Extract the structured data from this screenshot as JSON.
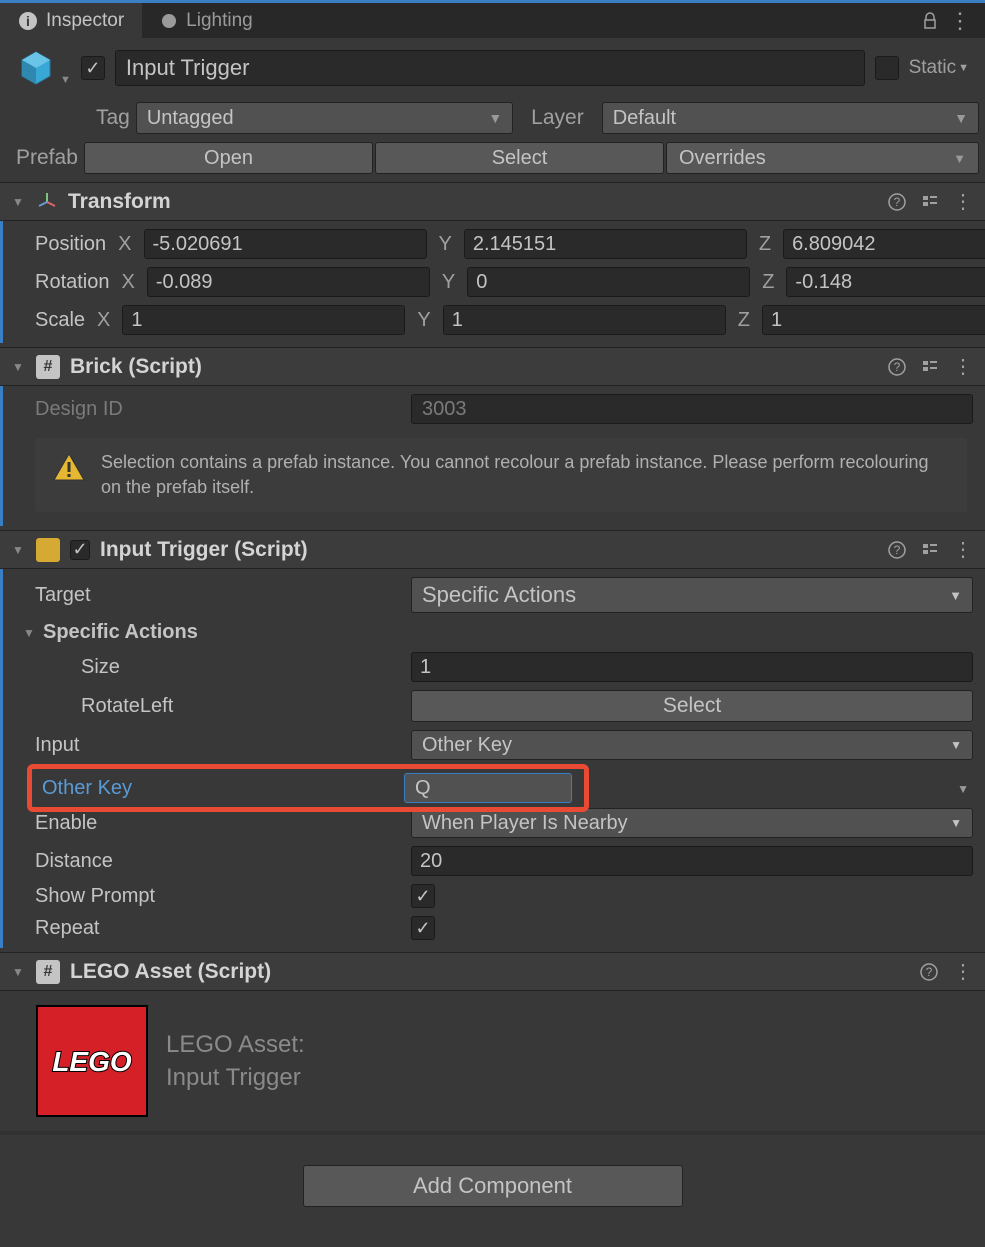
{
  "tabs": {
    "inspector": "Inspector",
    "lighting": "Lighting"
  },
  "header": {
    "name": "Input Trigger",
    "static": "Static",
    "tag_label": "Tag",
    "tag_value": "Untagged",
    "layer_label": "Layer",
    "layer_value": "Default"
  },
  "prefab": {
    "label": "Prefab",
    "open": "Open",
    "select": "Select",
    "overrides": "Overrides"
  },
  "transform": {
    "title": "Transform",
    "position": {
      "label": "Position",
      "x": "-5.020691",
      "y": "2.145151",
      "z": "6.809042"
    },
    "rotation": {
      "label": "Rotation",
      "x": "-0.089",
      "y": "0",
      "z": "-0.148"
    },
    "scale": {
      "label": "Scale",
      "x": "1",
      "y": "1",
      "z": "1"
    }
  },
  "brick": {
    "title": "Brick (Script)",
    "design_id_label": "Design ID",
    "design_id_value": "3003",
    "warning": "Selection contains a prefab instance. You cannot recolour a prefab instance. Please perform recolouring on the prefab itself."
  },
  "input_trigger": {
    "title": "Input Trigger (Script)",
    "target_label": "Target",
    "target_value": "Specific Actions",
    "specific_actions_label": "Specific Actions",
    "size_label": "Size",
    "size_value": "1",
    "rotate_left_label": "RotateLeft",
    "rotate_left_btn": "Select",
    "input_label": "Input",
    "input_value": "Other Key",
    "other_key_label": "Other Key",
    "other_key_value": "Q",
    "enable_label": "Enable",
    "enable_value": "When Player Is Nearby",
    "distance_label": "Distance",
    "distance_value": "20",
    "show_prompt_label": "Show Prompt",
    "repeat_label": "Repeat"
  },
  "lego_asset": {
    "title": "LEGO Asset (Script)",
    "heading": "LEGO Asset:",
    "value": "Input Trigger"
  },
  "footer": {
    "add_component": "Add Component"
  }
}
